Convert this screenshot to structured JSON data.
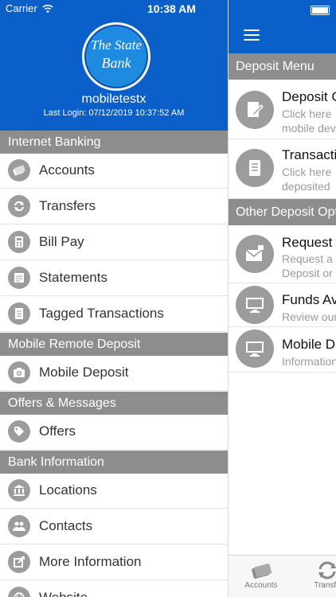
{
  "status_bar": {
    "carrier": "Carrier",
    "time": "10:38 AM"
  },
  "drawer": {
    "bank_logo": {
      "line1": "The State",
      "line2": "Bank"
    },
    "username": "mobiletestx",
    "last_login": "Last Login: 07/12/2019 10:37:52 AM",
    "sections": [
      {
        "title": "Internet Banking",
        "items": [
          {
            "label": "Accounts",
            "icon": "credit-card-icon"
          },
          {
            "label": "Transfers",
            "icon": "transfer-icon"
          },
          {
            "label": "Bill Pay",
            "icon": "calculator-icon"
          },
          {
            "label": "Statements",
            "icon": "statement-icon"
          },
          {
            "label": "Tagged Transactions",
            "icon": "tag-transaction-icon"
          }
        ]
      },
      {
        "title": "Mobile Remote Deposit",
        "items": [
          {
            "label": "Mobile Deposit",
            "icon": "camera-icon"
          }
        ]
      },
      {
        "title": "Offers & Messages",
        "items": [
          {
            "label": "Offers",
            "icon": "tag-icon"
          }
        ]
      },
      {
        "title": "Bank Information",
        "items": [
          {
            "label": "Locations",
            "icon": "bank-building-icon"
          },
          {
            "label": "Contacts",
            "icon": "contacts-icon"
          },
          {
            "label": "More Information",
            "icon": "share-icon"
          },
          {
            "label": "Website",
            "icon": "globe-icon"
          }
        ]
      }
    ]
  },
  "main": {
    "menu_icon": "hamburger-icon",
    "sections": [
      {
        "title": "Deposit Menu",
        "items": [
          {
            "title": "Deposit C",
            "subtitle_lines": [
              "Click here",
              "mobile dev"
            ],
            "icon": "check-edit-icon"
          },
          {
            "title": "Transacti",
            "subtitle_lines": [
              "Click here",
              "deposited"
            ],
            "icon": "document-icon"
          }
        ]
      },
      {
        "title": "Other Deposit Opt",
        "items": [
          {
            "title": "Request",
            "subtitle_lines": [
              "Request a",
              "Deposit or"
            ],
            "icon": "secure-mail-icon"
          },
          {
            "title": "Funds Av",
            "subtitle_lines": [
              "Review our"
            ],
            "icon": "monitor-icon"
          },
          {
            "title": "Mobile D",
            "subtitle_lines": [
              "Information"
            ],
            "icon": "monitor-icon"
          }
        ]
      }
    ],
    "tab_bar": [
      {
        "label": "Accounts",
        "icon": "credit-card-icon"
      },
      {
        "label": "Transfe",
        "icon": "transfer-icon"
      }
    ]
  },
  "colors": {
    "header_blue": "#0b5fc9",
    "section_gray": "#8d8d8d",
    "icon_gray": "#9c9c9c"
  }
}
